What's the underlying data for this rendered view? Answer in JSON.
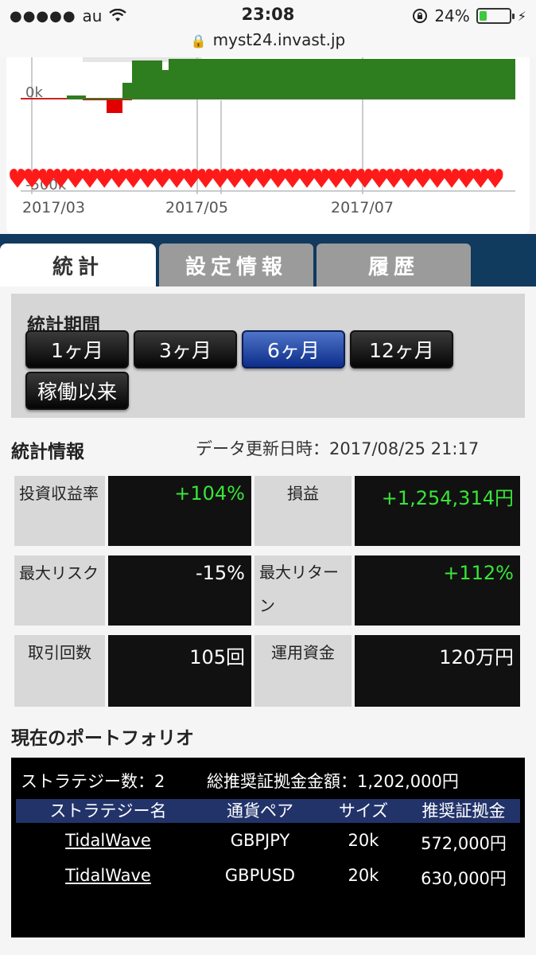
{
  "status_bar": {
    "carrier": "au",
    "time": "23:08",
    "battery_percent": "24%",
    "battery_level": 0.24,
    "url": "myst24.invast.jp"
  },
  "chart": {
    "y_tick_labels": [
      "0k",
      "-500k"
    ],
    "x_tick_labels": [
      "2017/03",
      "2017/05",
      "2017/07"
    ],
    "colors": {
      "profit": "#2e7d1f",
      "loss": "#e00000",
      "marker": "#ff1a1a"
    }
  },
  "tabs": [
    {
      "label": "統計",
      "active": true
    },
    {
      "label": "設定情報",
      "active": false
    },
    {
      "label": "履歴",
      "active": false
    }
  ],
  "period": {
    "title": "統計期間",
    "options": [
      "1ヶ月",
      "3ヶ月",
      "6ヶ月",
      "12ヶ月",
      "稼働以来"
    ],
    "selected": "6ヶ月"
  },
  "stats": {
    "title": "統計情報",
    "updated": "データ更新日時：2017/08/25 21:17",
    "roi_label": "投資収益率",
    "roi_value": "+104%",
    "pnl_label": "損益",
    "pnl_value": "+1,254,314円",
    "max_risk_label": "最大リスク",
    "max_risk_value": "-15%",
    "max_return_label": "最大リターン",
    "max_return_value": "+112%",
    "trades_label": "取引回数",
    "trades_value": "105回",
    "capital_label": "運用資金",
    "capital_value": "120万円"
  },
  "portfolio": {
    "title": "現在のポートフォリオ",
    "strategy_count": "ストラテジー数：2",
    "total_margin": "総推奨証拠金金額：1,202,000円",
    "columns": [
      "ストラテジー名",
      "通貨ペア",
      "サイズ",
      "推奨証拠金"
    ],
    "rows": [
      {
        "name": "TidalWave",
        "pair": "GBPJPY",
        "size": "20k",
        "margin": "572,000円"
      },
      {
        "name": "TidalWave",
        "pair": "GBPUSD",
        "size": "20k",
        "margin": "630,000円"
      }
    ]
  }
}
